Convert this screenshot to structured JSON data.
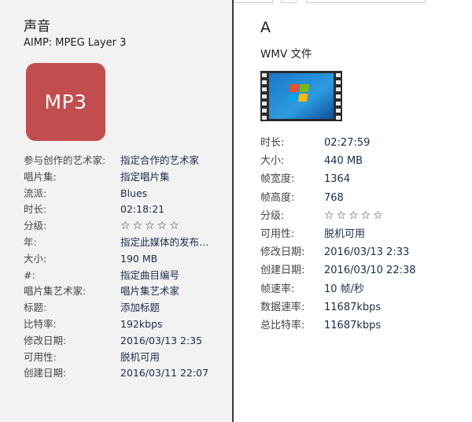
{
  "left_panel": {
    "title": "声音",
    "subtitle": "AIMP: MPEG Layer 3",
    "thumbnail_text": "MP3",
    "thumbnail_color": "#c24d4f",
    "properties": [
      {
        "key": "参与创作的艺术家:",
        "value": "指定合作的艺术家"
      },
      {
        "key": "唱片集:",
        "value": "指定唱片集"
      },
      {
        "key": "流派:",
        "value": "Blues"
      },
      {
        "key": "时长:",
        "value": "02:18:21"
      },
      {
        "key": "分级:",
        "value": "☆☆☆☆☆"
      },
      {
        "key": "年:",
        "value": "指定此媒体的发布…"
      },
      {
        "key": "大小:",
        "value": "190 MB"
      },
      {
        "key": "#:",
        "value": "指定曲目编号"
      },
      {
        "key": "唱片集艺术家:",
        "value": "唱片集艺术家"
      },
      {
        "key": "标题:",
        "value": "添加标题"
      },
      {
        "key": "比特率:",
        "value": "192kbps"
      },
      {
        "key": "修改日期:",
        "value": "2016/03/13 2:35"
      },
      {
        "key": "可用性:",
        "value": "脱机可用"
      },
      {
        "key": "创建日期:",
        "value": "2016/03/11 22:07"
      }
    ]
  },
  "right_panel": {
    "title": "A",
    "subtitle": "WMV 文件",
    "thumbnail_icon": "video-filmstrip-windows-logo-icon",
    "properties": [
      {
        "key": "时长:",
        "value": "02:27:59"
      },
      {
        "key": "大小:",
        "value": "440 MB"
      },
      {
        "key": "帧宽度:",
        "value": "1364"
      },
      {
        "key": "帧高度:",
        "value": "768"
      },
      {
        "key": "分级:",
        "value": "☆☆☆☆☆"
      },
      {
        "key": "可用性:",
        "value": "脱机可用"
      },
      {
        "key": "修改日期:",
        "value": "2016/03/13 2:33"
      },
      {
        "key": "创建日期:",
        "value": "2016/03/10 22:38"
      },
      {
        "key": "帧速率:",
        "value": "10 帧/秒"
      },
      {
        "key": "数据速率:",
        "value": "11687kbps"
      },
      {
        "key": "总比特率:",
        "value": "11687kbps"
      }
    ]
  },
  "colors": {
    "left_background": "#f2f2f2",
    "right_background": "#ffffff",
    "divider": "#3a3a3a",
    "value_text": "#1a2b4c"
  }
}
